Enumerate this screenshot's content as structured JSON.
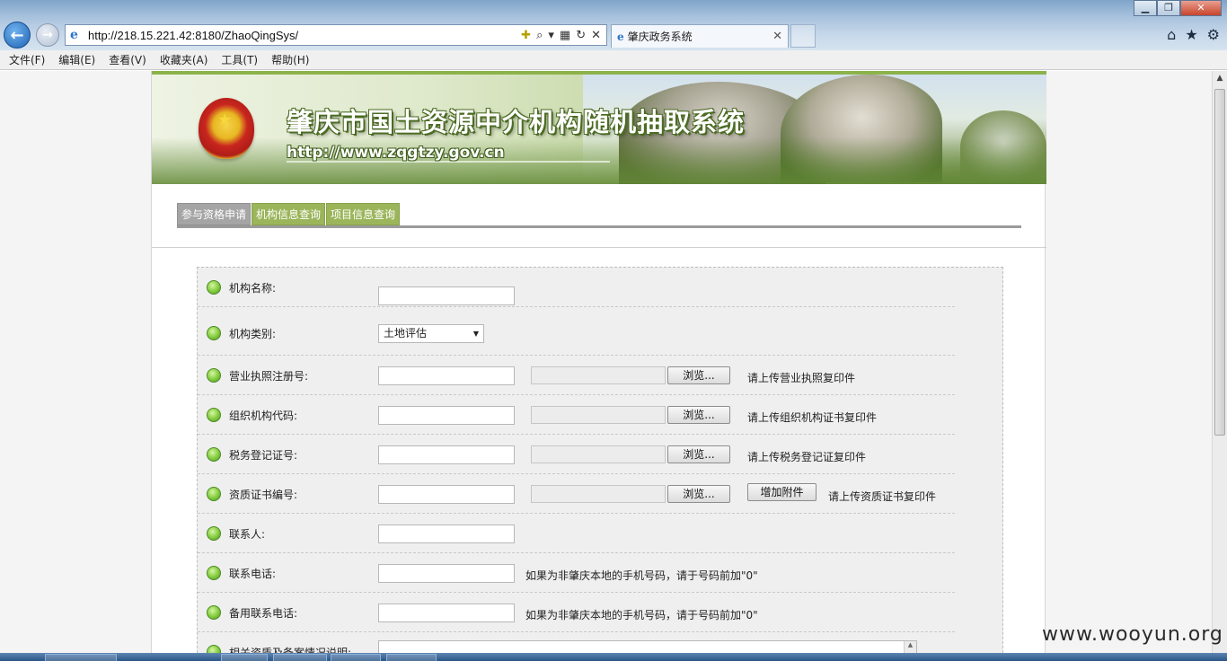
{
  "browser": {
    "address": "http://218.15.221.42:8180/ZhaoQingSys/",
    "tab_title": "肇庆政务系统",
    "window_controls": {
      "minimize": "▁",
      "restore": "❐",
      "close": "✕"
    },
    "right_icons": [
      "home-icon",
      "star-icon",
      "gear-icon"
    ]
  },
  "menu": [
    "文件(F)",
    "编辑(E)",
    "查看(V)",
    "收藏夹(A)",
    "工具(T)",
    "帮助(H)"
  ],
  "banner": {
    "title": "肇庆市国土资源中介机构随机抽取系统",
    "url": "http://www.zqgtzy.gov.cn"
  },
  "tabs": [
    "参与资格申请",
    "机构信息查询",
    "项目信息查询"
  ],
  "form": {
    "rows": [
      {
        "label": "机构名称:"
      },
      {
        "label": "机构类别:",
        "select_value": "土地评估"
      },
      {
        "label": "营业执照注册号:",
        "browse": "浏览...",
        "hint": "请上传营业执照复印件"
      },
      {
        "label": "组织机构代码:",
        "browse": "浏览...",
        "hint": "请上传组织机构证书复印件"
      },
      {
        "label": "税务登记证号:",
        "browse": "浏览...",
        "hint": "请上传税务登记证复印件"
      },
      {
        "label": "资质证书编号:",
        "browse": "浏览...",
        "add_button": "增加附件",
        "hint": "请上传资质证书复印件"
      },
      {
        "label": "联系人:"
      },
      {
        "label": "联系电话:",
        "hint": "如果为非肇庆本地的手机号码，请于号码前加\"0\""
      },
      {
        "label": "备用联系电话:",
        "hint": "如果为非肇庆本地的手机号码，请于号码前加\"0\""
      },
      {
        "label": "相关资质及备案情况说明:"
      }
    ]
  },
  "watermark": "www.wooyun.org",
  "colors": {
    "tab_green": "#9bb55a",
    "tab_active": "#a5a5a5",
    "dot_green": "#8fd34a",
    "top_line": "#8cb34a"
  }
}
